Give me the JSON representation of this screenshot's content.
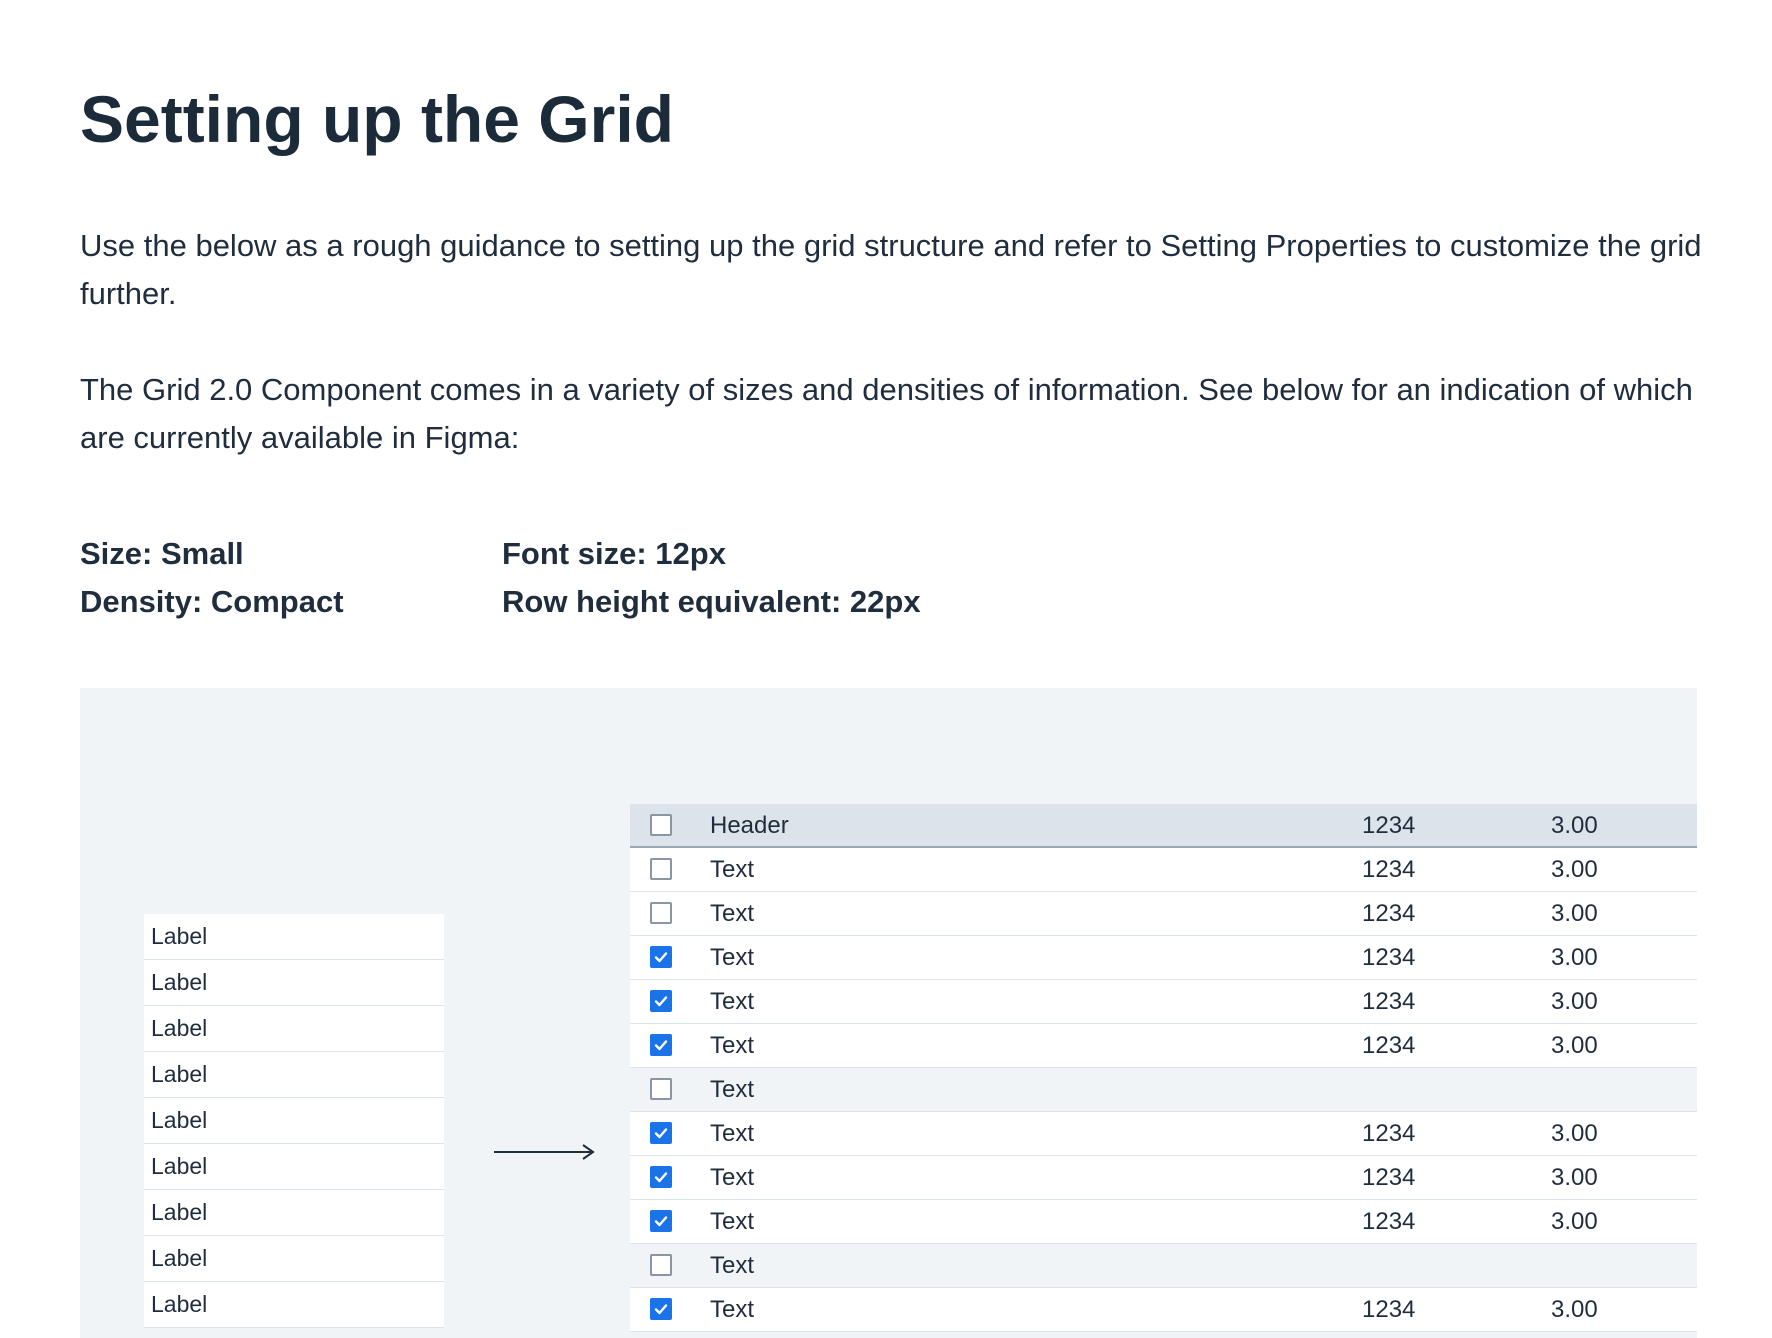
{
  "page": {
    "title": "Setting up the Grid",
    "paragraphs": [
      "Use the below as a rough guidance to setting up the grid structure and refer to Setting Properties to customize the grid further.",
      "The Grid 2.0 Component comes in a variety of sizes and densities of information. See below for an indication of which are currently available in Figma:"
    ],
    "specs": {
      "size": "Size: Small",
      "density": "Density: Compact",
      "font_size": "Font size: 12px",
      "row_height": "Row height equivalent: 22px"
    }
  },
  "label_list": {
    "items": [
      "Label",
      "Label",
      "Label",
      "Label",
      "Label",
      "Label",
      "Label",
      "Label",
      "Label"
    ]
  },
  "arrow_icon": "arrow-right-icon",
  "grid": {
    "header": {
      "checked": false,
      "text": "Header",
      "num": "1234",
      "dec": "3.00"
    },
    "rows": [
      {
        "type": "row",
        "checked": false,
        "text": "Text",
        "num": "1234",
        "dec": "3.00"
      },
      {
        "type": "row",
        "checked": false,
        "text": "Text",
        "num": "1234",
        "dec": "3.00"
      },
      {
        "type": "row",
        "checked": true,
        "text": "Text",
        "num": "1234",
        "dec": "3.00"
      },
      {
        "type": "row",
        "checked": true,
        "text": "Text",
        "num": "1234",
        "dec": "3.00"
      },
      {
        "type": "row",
        "checked": true,
        "text": "Text",
        "num": "1234",
        "dec": "3.00"
      },
      {
        "type": "group",
        "checked": false,
        "text": "Text",
        "num": "",
        "dec": ""
      },
      {
        "type": "row",
        "checked": true,
        "text": "Text",
        "num": "1234",
        "dec": "3.00"
      },
      {
        "type": "row",
        "checked": true,
        "text": "Text",
        "num": "1234",
        "dec": "3.00"
      },
      {
        "type": "row",
        "checked": true,
        "text": "Text",
        "num": "1234",
        "dec": "3.00"
      },
      {
        "type": "group",
        "checked": false,
        "text": "Text",
        "num": "",
        "dec": ""
      },
      {
        "type": "row",
        "checked": true,
        "text": "Text",
        "num": "1234",
        "dec": "3.00"
      }
    ]
  },
  "colors": {
    "checkbox_checked": "#1a73e8",
    "header_bg": "#dde3ea",
    "panel_bg": "#f1f4f7"
  }
}
